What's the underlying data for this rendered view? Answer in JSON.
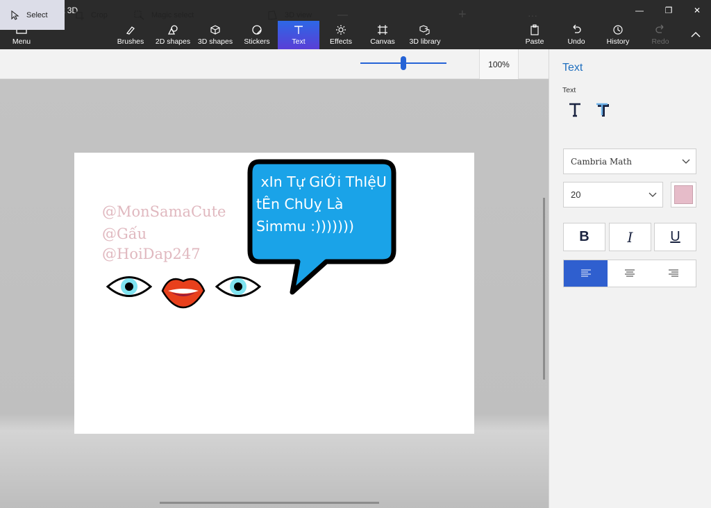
{
  "window": {
    "title": "Untitled* - Paint 3D",
    "controls": {
      "minimize": "—",
      "restore": "❐",
      "close": "✕"
    }
  },
  "ribbon": {
    "menu_label": "Menu",
    "tabs": [
      {
        "label": "Brushes",
        "icon": "brush-icon"
      },
      {
        "label": "2D shapes",
        "icon": "2d-shapes-icon"
      },
      {
        "label": "3D shapes",
        "icon": "3d-shapes-icon"
      },
      {
        "label": "Stickers",
        "icon": "stickers-icon"
      },
      {
        "label": "Text",
        "icon": "text-icon",
        "active": true
      },
      {
        "label": "Effects",
        "icon": "effects-icon"
      },
      {
        "label": "Canvas",
        "icon": "canvas-icon"
      },
      {
        "label": "3D library",
        "icon": "3d-library-icon"
      }
    ],
    "right": [
      {
        "label": "Paste",
        "icon": "paste-icon"
      },
      {
        "label": "Undo",
        "icon": "undo-icon"
      },
      {
        "label": "History",
        "icon": "history-icon"
      },
      {
        "label": "Redo",
        "icon": "redo-icon",
        "disabled": true
      }
    ]
  },
  "toolbar": {
    "select_label": "Select",
    "crop_label": "Crop",
    "magic_select_label": "Magic select",
    "view3d_label": "3D view",
    "zoom_out": "—",
    "zoom_in": "+",
    "zoom_value": "100%",
    "zoom_fraction": 0.5,
    "more": "···"
  },
  "canvas": {
    "watermarks": [
      "@MonSamaCute",
      "@Gấu",
      "@HoiDap247"
    ],
    "bubble_lines": [
      " xIn Tự GiỚi ThIệU",
      "tÊn ChUỵ Là",
      "Simmu :)))))))"
    ],
    "bubble_color": "#1aa3e8",
    "watermark_color": "#e0b8bf"
  },
  "panel": {
    "title": "Text",
    "subtitle": "Text",
    "font": "Cambria Math",
    "size": "20",
    "swatch_color": "#e6bcc9",
    "bold": "B",
    "italic": "I",
    "underline": "U",
    "accent": "#2f5fcf"
  }
}
